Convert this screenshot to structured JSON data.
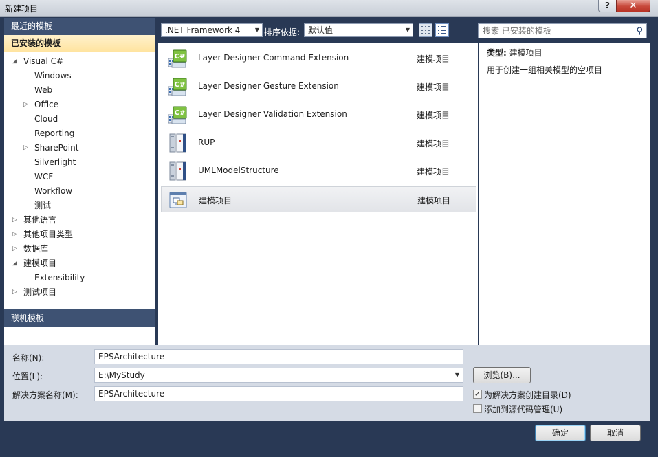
{
  "window": {
    "title": "新建项目",
    "help_glyph": "?",
    "close_glyph": "✕"
  },
  "left_pane": {
    "recent_header": "最近的模板",
    "installed_header": "已安装的模板",
    "tree": [
      {
        "label": "Visual C#",
        "level": 0,
        "arrow": "◢"
      },
      {
        "label": "Windows",
        "level": 1,
        "arrow": ""
      },
      {
        "label": "Web",
        "level": 1,
        "arrow": ""
      },
      {
        "label": "Office",
        "level": 1,
        "arrow": "▷"
      },
      {
        "label": "Cloud",
        "level": 1,
        "arrow": ""
      },
      {
        "label": "Reporting",
        "level": 1,
        "arrow": ""
      },
      {
        "label": "SharePoint",
        "level": 1,
        "arrow": "▷"
      },
      {
        "label": "Silverlight",
        "level": 1,
        "arrow": ""
      },
      {
        "label": "WCF",
        "level": 1,
        "arrow": ""
      },
      {
        "label": "Workflow",
        "level": 1,
        "arrow": ""
      },
      {
        "label": "测试",
        "level": 1,
        "arrow": ""
      },
      {
        "label": "其他语言",
        "level": 0,
        "arrow": "▷"
      },
      {
        "label": "其他项目类型",
        "level": 0,
        "arrow": "▷"
      },
      {
        "label": "数据库",
        "level": 0,
        "arrow": "▷"
      },
      {
        "label": "建模项目",
        "level": 0,
        "arrow": "◢"
      },
      {
        "label": "Extensibility",
        "level": 1,
        "arrow": ""
      },
      {
        "label": "测试项目",
        "level": 0,
        "arrow": "▷"
      }
    ],
    "online_header": "联机模板"
  },
  "toolbar": {
    "framework": ".NET Framework 4",
    "sort_label": "排序依据:",
    "sort_value": "默认值",
    "search_placeholder": "搜索 已安装的模板"
  },
  "templates": [
    {
      "name": "Layer Designer Command Extension",
      "type": "建模项目",
      "icon": "csharp-project-icon"
    },
    {
      "name": "Layer Designer Gesture Extension",
      "type": "建模项目",
      "icon": "csharp-project-icon"
    },
    {
      "name": "Layer Designer Validation Extension",
      "type": "建模项目",
      "icon": "csharp-project-icon"
    },
    {
      "name": "RUP",
      "type": "建模项目",
      "icon": "model-structure-icon"
    },
    {
      "name": "UMLModelStructure",
      "type": "建模项目",
      "icon": "model-structure-icon"
    },
    {
      "name": "建模项目",
      "type": "建模项目",
      "icon": "modeling-project-icon",
      "selected": true
    }
  ],
  "info": {
    "type_label": "类型:",
    "type_value": "建模项目",
    "description": "用于创建一组相关模型的空项目"
  },
  "form": {
    "name_label": "名称(N):",
    "name_value": "EPSArchitecture",
    "location_label": "位置(L):",
    "location_value": "E:\\MyStudy",
    "solution_label": "解决方案名称(M):",
    "solution_value": "EPSArchitecture",
    "browse_label": "浏览(B)...",
    "create_dir_label": "为解决方案创建目录(D)",
    "create_dir_checked": true,
    "source_control_label": "添加到源代码管理(U)",
    "source_control_checked": false
  },
  "buttons": {
    "ok": "确定",
    "cancel": "取消"
  }
}
